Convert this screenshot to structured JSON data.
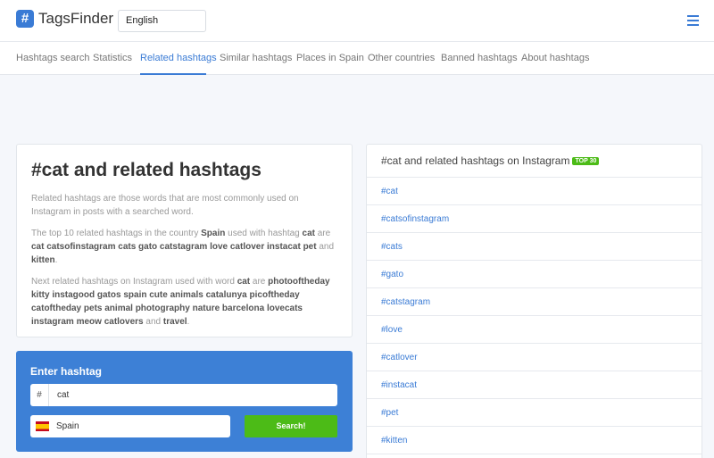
{
  "header": {
    "logo_mark": "#",
    "logo_text": "TagsFinder",
    "language": "English"
  },
  "nav": {
    "items": [
      {
        "label": "Hashtags search"
      },
      {
        "label": "Statistics"
      },
      {
        "label": "Related hashtags",
        "active": true
      },
      {
        "label": "Similar hashtags"
      },
      {
        "label": "Places in Spain"
      },
      {
        "label": "Other countries"
      },
      {
        "label": "Banned hashtags"
      },
      {
        "label": "About hashtags"
      }
    ]
  },
  "info": {
    "title": "#cat and related hashtags",
    "p1": "Related hashtags are those words that are most commonly used on Instagram in posts with a searched word.",
    "p2_a": "The top 10 related hashtags in the country ",
    "p2_country": "Spain",
    "p2_b": " used with hashtag ",
    "p2_tag": "cat",
    "p2_c": " are ",
    "p2_list": "cat catsofinstagram cats gato catstagram love catlover instacat pet",
    "p2_d": " and ",
    "p2_last": "kitten",
    "p2_e": ".",
    "p3_a": "Next related hashtags on Instagram used with word ",
    "p3_tag": "cat",
    "p3_b": " are ",
    "p3_list": "photooftheday kitty instagood gatos spain cute animals catalunya picoftheday catoftheday pets animal photography nature barcelona lovecats instagram meow catlovers",
    "p3_c": " and ",
    "p3_last": "travel",
    "p3_d": "."
  },
  "search": {
    "title": "Enter hashtag",
    "prefix": "#",
    "value": "cat",
    "country": "Spain",
    "button": "Search!"
  },
  "tags": {
    "title": "#cat and related hashtags on Instagram",
    "badge": "TOP 30",
    "list": [
      "#cat",
      "#catsofinstagram",
      "#cats",
      "#gato",
      "#catstagram",
      "#love",
      "#catlover",
      "#instacat",
      "#pet",
      "#kitten"
    ]
  },
  "colors": {
    "accent": "#3a7bd5",
    "search_panel": "#3d80d6",
    "button_green": "#4cbb17"
  }
}
